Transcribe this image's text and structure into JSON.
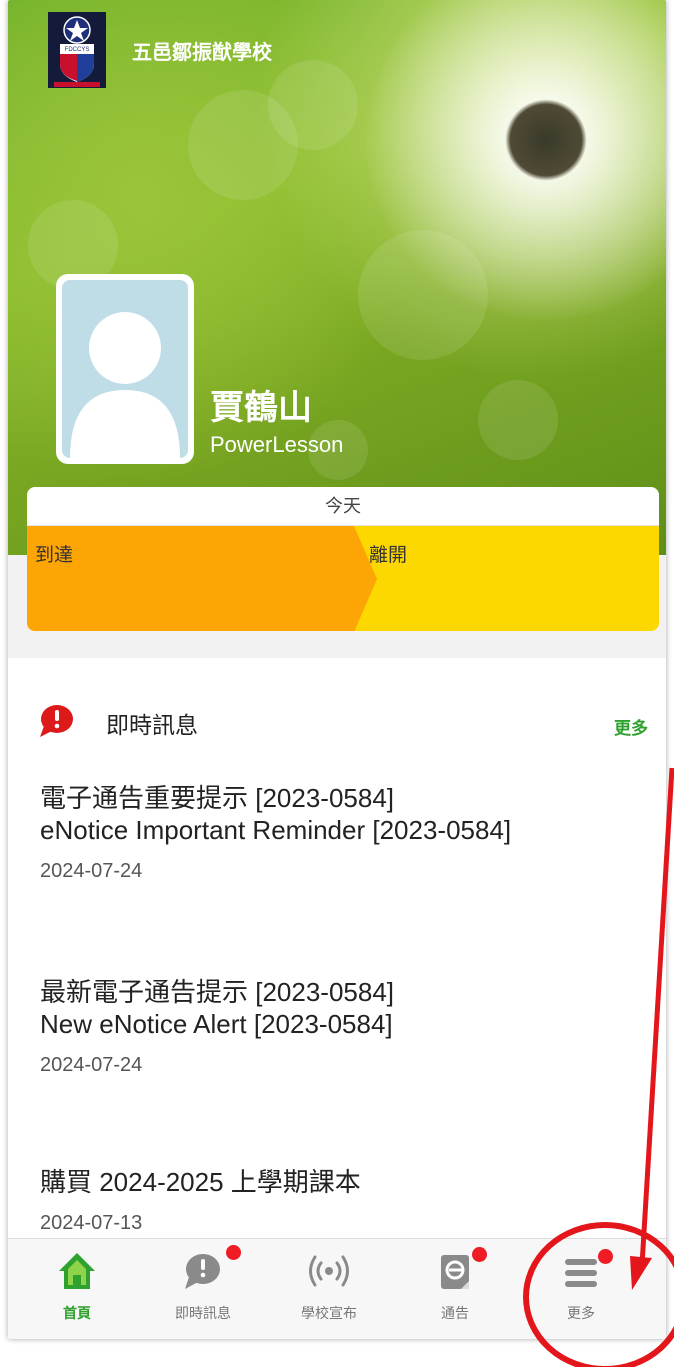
{
  "header": {
    "school_name": "五邑鄒振猷學校",
    "logo_text": "FDCCYS",
    "logo_motto": "敬業樂群自強不息"
  },
  "profile": {
    "name": "賈鶴山",
    "subtitle": "PowerLesson"
  },
  "attendance": {
    "day_label": "今天",
    "arrive_label": "到達",
    "leave_label": "離開",
    "colors": {
      "arrive": "#fda505",
      "leave": "#fbe000"
    }
  },
  "messages": {
    "section_title": "即時訊息",
    "more_label": "更多",
    "items": [
      {
        "title_zh": "電子通告重要提示 [2023-0584]",
        "title_en": "eNotice Important Reminder [2023-0584]",
        "date": "2024-07-24"
      },
      {
        "title_zh": "最新電子通告提示 [2023-0584]",
        "title_en": "New eNotice Alert [2023-0584]",
        "date": "2024-07-24"
      },
      {
        "title_zh": "購買 2024-2025 上學期課本",
        "title_en": "",
        "date": "2024-07-13"
      }
    ]
  },
  "tabbar": {
    "tabs": [
      {
        "label": "首頁",
        "icon": "home-icon",
        "active": true,
        "badge": false
      },
      {
        "label": "即時訊息",
        "icon": "chat-alert-icon",
        "active": false,
        "badge": true
      },
      {
        "label": "學校宣布",
        "icon": "broadcast-icon",
        "active": false,
        "badge": false
      },
      {
        "label": "通告",
        "icon": "notice-icon",
        "active": false,
        "badge": true
      },
      {
        "label": "更多",
        "icon": "menu-icon",
        "active": false,
        "badge": true
      }
    ]
  },
  "colors": {
    "accent_green": "#2ea12e",
    "badge_red": "#ee1c25",
    "annotation_red": "#e3161b"
  }
}
